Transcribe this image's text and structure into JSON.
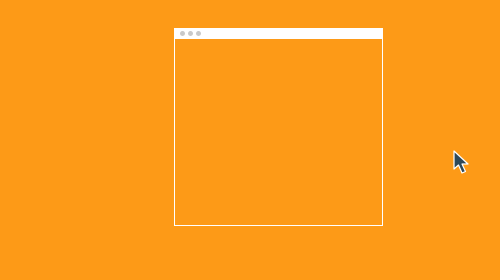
{
  "desktop": {
    "background_color": "#FD9A17"
  },
  "window": {
    "border_color": "#FFFFFF",
    "titlebar_color": "#FFFFFF",
    "control_dots": [
      {
        "name": "window-control-dot-1",
        "color": "#C9C9C9"
      },
      {
        "name": "window-control-dot-2",
        "color": "#C9C9C9"
      },
      {
        "name": "window-control-dot-3",
        "color": "#C9C9C9"
      }
    ]
  },
  "cursor": {
    "icon": "mouse-pointer-icon",
    "fill_color": "#2F4858",
    "outline_color": "#FFFFFF"
  }
}
